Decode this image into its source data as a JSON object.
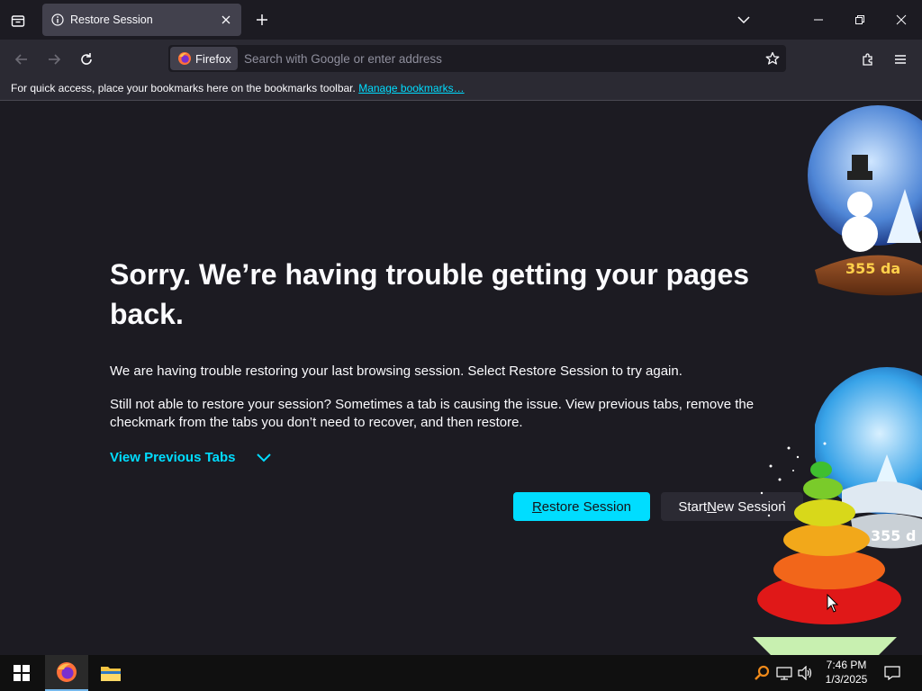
{
  "browser": {
    "tab": {
      "title": "Restore Session",
      "favicon": "info-icon"
    },
    "identity_label": "Firefox",
    "url_placeholder": "Search with Google or enter address"
  },
  "bookmarks_bar": {
    "text": "For quick access, place your bookmarks here on the bookmarks toolbar.",
    "link": "Manage bookmarks…"
  },
  "page": {
    "heading": "Sorry. We’re having trouble getting your pages back.",
    "paragraph1": "We are having trouble restoring your last browsing session. Select Restore Session to try again.",
    "paragraph2": "Still not able to restore your session? Sometimes a tab is causing the issue. View previous tabs, remove the checkmark from the tabs you don’t need to recover, and then restore.",
    "view_previous_tabs": "View Previous Tabs",
    "restore_button": {
      "accel": "R",
      "rest": "estore Session"
    },
    "new_session_button": {
      "pre": "Start ",
      "accel": "N",
      "rest": "ew Session"
    }
  },
  "gadgets": {
    "globe_counter": "355 da",
    "globe_counter2": "355 d"
  },
  "taskbar": {
    "time": "7:46 PM",
    "date": "1/3/2025"
  },
  "colors": {
    "accent": "#00ddff",
    "page_bg": "#1c1b22",
    "toolbar_bg": "#2b2a33",
    "tab_bg": "#42414d"
  }
}
